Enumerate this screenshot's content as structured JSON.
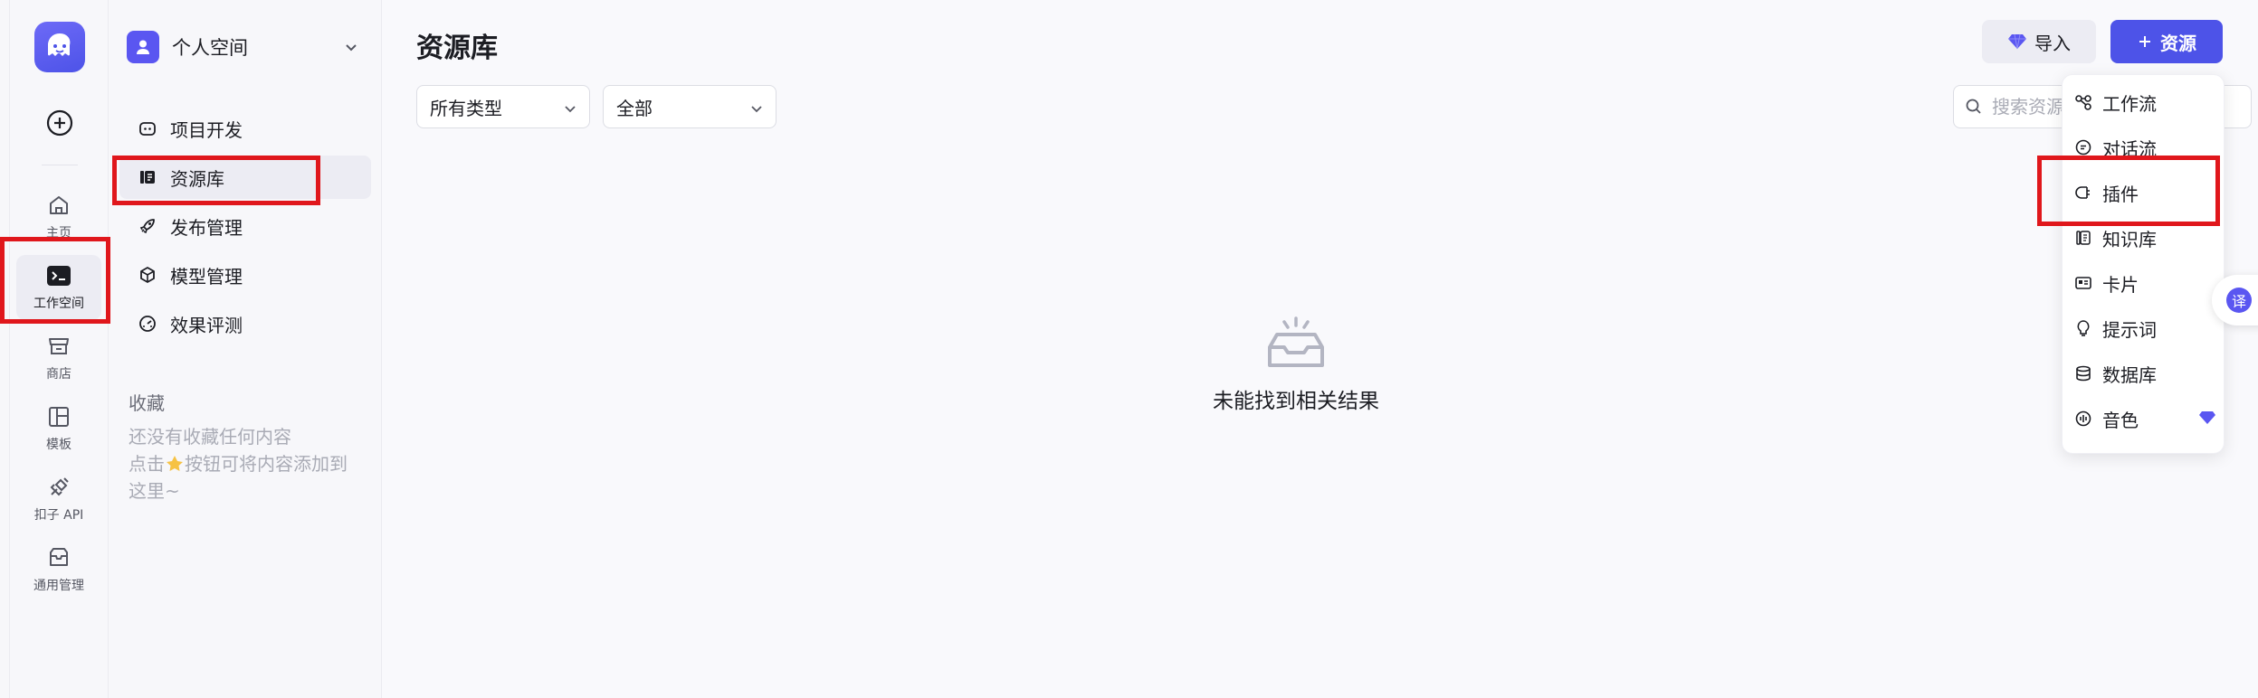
{
  "rail": {
    "items": [
      {
        "label": "主页",
        "icon": "home-icon"
      },
      {
        "label": "工作空间",
        "icon": "terminal-icon"
      },
      {
        "label": "商店",
        "icon": "store-icon"
      },
      {
        "label": "模板",
        "icon": "template-icon"
      },
      {
        "label": "扣子 API",
        "icon": "api-icon"
      },
      {
        "label": "通用管理",
        "icon": "inbox-icon"
      }
    ]
  },
  "nav": {
    "space_name": "个人空间",
    "items": [
      {
        "label": "项目开发",
        "icon": "bot-icon"
      },
      {
        "label": "资源库",
        "icon": "library-icon"
      },
      {
        "label": "发布管理",
        "icon": "rocket-icon"
      },
      {
        "label": "模型管理",
        "icon": "cube-icon"
      },
      {
        "label": "效果评测",
        "icon": "gauge-icon"
      }
    ],
    "favorites_title": "收藏",
    "favorites_empty_line1": "还没有收藏任何内容",
    "favorites_empty_line2a": "点击",
    "favorites_empty_line2b": "按钮可将内容添加到",
    "favorites_empty_line3": "这里~"
  },
  "main": {
    "title": "资源库",
    "filter_type": "所有类型",
    "filter_scope": "全部",
    "search_placeholder": "搜索资源",
    "import_label": "导入",
    "add_resource_label": "资源",
    "empty_message": "未能找到相关结果"
  },
  "dropdown": {
    "items": [
      {
        "label": "工作流",
        "icon": "workflow-icon"
      },
      {
        "label": "对话流",
        "icon": "chatflow-icon"
      },
      {
        "label": "插件",
        "icon": "plugin-icon"
      },
      {
        "label": "知识库",
        "icon": "knowledge-icon"
      },
      {
        "label": "卡片",
        "icon": "card-icon"
      },
      {
        "label": "提示词",
        "icon": "prompt-icon"
      },
      {
        "label": "数据库",
        "icon": "database-icon"
      },
      {
        "label": "音色",
        "icon": "voice-icon"
      }
    ]
  },
  "translate_label": "译",
  "colors": {
    "accent": "#4d53e8",
    "highlight": "#e0171c",
    "premium": "#5a56f1"
  }
}
